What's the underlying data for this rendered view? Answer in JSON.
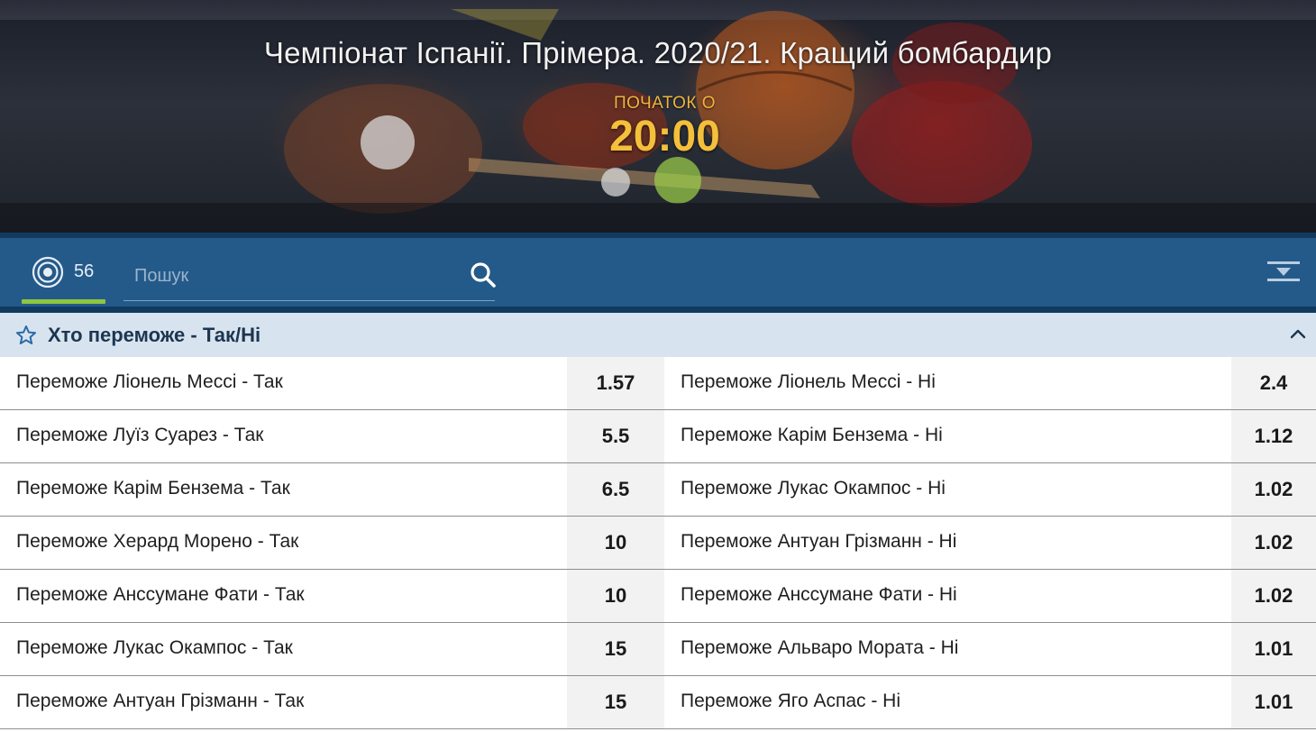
{
  "hero": {
    "title": "Чемпіонат Іспанії. Прімера. 2020/21. Кращий бомбардир",
    "start_label": "ПОЧАТОК О",
    "start_time": "20:00"
  },
  "toolbar": {
    "events_count": "56",
    "search_placeholder": "Пошук",
    "icons": [
      "events-target-icon",
      "search-icon",
      "collapse-all-icon"
    ],
    "accent_color": "#8dc63f"
  },
  "market": {
    "title": "Хто переможе - Так/Ні",
    "icons": [
      "star-icon",
      "chevron-up-icon"
    ],
    "rows": [
      {
        "left": {
          "name": "Переможе Ліонель Мессі - Так",
          "odd": "1.57"
        },
        "right": {
          "name": "Переможе Ліонель Мессі - Ні",
          "odd": "2.4"
        }
      },
      {
        "left": {
          "name": "Переможе Луїз Суарез - Так",
          "odd": "5.5"
        },
        "right": {
          "name": "Переможе Карім Бензема - Ні",
          "odd": "1.12"
        }
      },
      {
        "left": {
          "name": "Переможе Карім Бензема - Так",
          "odd": "6.5"
        },
        "right": {
          "name": "Переможе Лукас Окампос - Ні",
          "odd": "1.02"
        }
      },
      {
        "left": {
          "name": "Переможе Херард Морено - Так",
          "odd": "10"
        },
        "right": {
          "name": "Переможе Антуан Грізманн - Ні",
          "odd": "1.02"
        }
      },
      {
        "left": {
          "name": "Переможе Анссумане Фати - Так",
          "odd": "10"
        },
        "right": {
          "name": "Переможе Анссумане Фати - Ні",
          "odd": "1.02"
        }
      },
      {
        "left": {
          "name": "Переможе Лукас Окампос - Так",
          "odd": "15"
        },
        "right": {
          "name": "Переможе Альваро Мората - Ні",
          "odd": "1.01"
        }
      },
      {
        "left": {
          "name": "Переможе Антуан Грізманн - Так",
          "odd": "15"
        },
        "right": {
          "name": "Переможе Яго Аспас - Ні",
          "odd": "1.01"
        }
      }
    ]
  }
}
